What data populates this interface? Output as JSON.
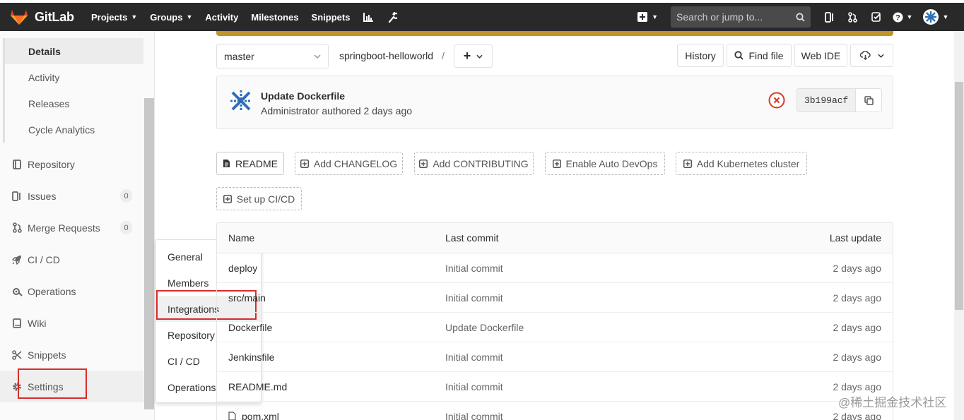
{
  "app": {
    "name": "GitLab"
  },
  "nav": {
    "links": [
      {
        "label": "Projects",
        "caret": true
      },
      {
        "label": "Groups",
        "caret": true
      },
      {
        "label": "Activity",
        "caret": false
      },
      {
        "label": "Milestones",
        "caret": false
      },
      {
        "label": "Snippets",
        "caret": false
      }
    ],
    "search_placeholder": "Search or jump to..."
  },
  "sidebar": {
    "subitems": [
      "Details",
      "Activity",
      "Releases",
      "Cycle Analytics"
    ],
    "active_subitem": "Details",
    "items": [
      {
        "label": "Repository",
        "icon": "document-icon",
        "badge": null
      },
      {
        "label": "Issues",
        "icon": "issues-icon",
        "badge": "0"
      },
      {
        "label": "Merge Requests",
        "icon": "merge-request-icon",
        "badge": "0"
      },
      {
        "label": "CI / CD",
        "icon": "rocket-icon",
        "badge": null
      },
      {
        "label": "Operations",
        "icon": "cloud-gear-icon",
        "badge": null
      },
      {
        "label": "Wiki",
        "icon": "book-icon",
        "badge": null
      },
      {
        "label": "Snippets",
        "icon": "scissors-icon",
        "badge": null
      },
      {
        "label": "Settings",
        "icon": "gear-icon",
        "badge": null
      }
    ]
  },
  "settings_flyout": {
    "items": [
      "General",
      "Members",
      "Integrations",
      "Repository",
      "CI / CD",
      "Operations"
    ],
    "highlighted": "Integrations"
  },
  "repo": {
    "branch": "master",
    "breadcrumb": "springboot-helloworld",
    "breadcrumb_sep": "/",
    "add_label": "+",
    "buttons": {
      "history": "History",
      "find_file": "Find file",
      "web_ide": "Web IDE"
    }
  },
  "commit": {
    "title": "Update Dockerfile",
    "author_line": "Administrator authored 2 days ago",
    "sha": "3b199acf",
    "pipeline_status": "failed"
  },
  "quick_actions": [
    "README",
    "Add CHANGELOG",
    "Add CONTRIBUTING",
    "Enable Auto DevOps",
    "Add Kubernetes cluster",
    "Set up CI/CD"
  ],
  "file_table": {
    "headers": {
      "name": "Name",
      "last_commit": "Last commit",
      "last_update": "Last update"
    },
    "rows": [
      {
        "name": "deploy",
        "commit": "Initial commit",
        "updated": "2 days ago"
      },
      {
        "name": "src/main",
        "commit": "Initial commit",
        "updated": "2 days ago"
      },
      {
        "name": "Dockerfile",
        "commit": "Update Dockerfile",
        "updated": "2 days ago"
      },
      {
        "name": "Jenkinsfile",
        "commit": "Initial commit",
        "updated": "2 days ago"
      },
      {
        "name": "README.md",
        "commit": "Initial commit",
        "updated": "2 days ago"
      },
      {
        "name": "pom.xml",
        "commit": "Initial commit",
        "updated": "2 days ago"
      }
    ]
  },
  "watermark": "@稀土掘金技术社区",
  "colors": {
    "topbar": "#292929",
    "pipeline_bar": "#c0932b",
    "highlight_box": "#d92b2b",
    "failed": "#db3b21"
  }
}
